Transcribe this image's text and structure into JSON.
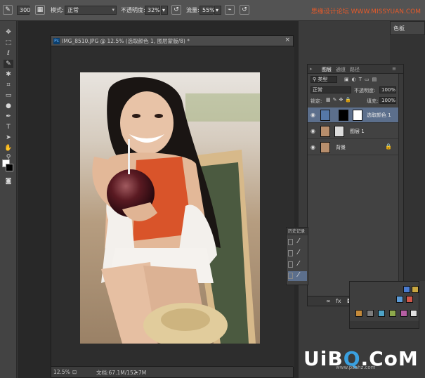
{
  "watermark": "思缘设计论坛 WWW.MISSYUAN.COM",
  "options_bar": {
    "brush_size": "300",
    "mode_label": "模式:",
    "mode_value": "正常",
    "opacity_label": "不透明度:",
    "opacity_value": "32%",
    "flow_label": "流量:",
    "flow_value": "55%"
  },
  "document": {
    "tab_title": "IMG_8510.JPG @ 12.5% (选取颜色 1, 图层蒙版/8) *",
    "zoom": "12.5%",
    "doc_info": "文档:67.1M/152.7M"
  },
  "color_panel": {
    "label": "色板"
  },
  "layers_panel": {
    "tabs": [
      "图层",
      "通道",
      "路径"
    ],
    "kind_filter": "类型",
    "blend_mode": "正常",
    "opacity_label": "不透明度:",
    "opacity_value": "100%",
    "lock_label": "锁定:",
    "fill_label": "填充:",
    "fill_value": "100%",
    "layers": [
      {
        "name": "选取颜色 1",
        "active": true
      },
      {
        "name": "图层 1",
        "active": false
      },
      {
        "name": "背景",
        "active": false
      }
    ],
    "footer_icons": [
      "link-icon",
      "fx-icon",
      "mask-icon",
      "adjustment-icon",
      "group-icon",
      "new-layer-icon",
      "trash-icon"
    ]
  },
  "history_panel": {
    "title": "历史记录",
    "steps": [
      "brush-step",
      "brush-step",
      "brush-step",
      "brush-step"
    ]
  },
  "logo": {
    "text_u": "Ui",
    "text_b": "B",
    "text_q": "Q",
    "text_rest": ".CoM",
    "small": "www.psahz.com"
  },
  "accent_colors": {
    "panel_bg": "#424242",
    "active_layer": "#5c6f8c",
    "watermark": "#e65a2a"
  }
}
